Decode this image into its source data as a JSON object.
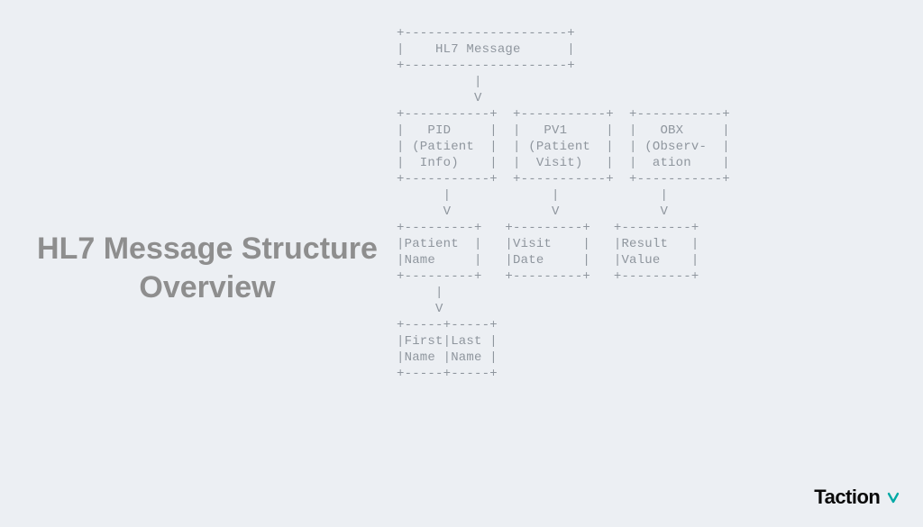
{
  "title": "HL7 Message Structure Overview",
  "brand": "Taction",
  "diagram": {
    "root": {
      "label": "HL7 Message"
    },
    "segments": [
      {
        "code": "PID",
        "description_lines": [
          "(Patient",
          "Info)"
        ]
      },
      {
        "code": "PV1",
        "description_lines": [
          "(Patient",
          "Visit)"
        ]
      },
      {
        "code": "OBX",
        "description_lines": [
          "(Observ-",
          "ation"
        ]
      }
    ],
    "fields": [
      {
        "lines": [
          "Patient",
          "Name"
        ]
      },
      {
        "lines": [
          "Visit",
          "Date"
        ]
      },
      {
        "lines": [
          "Result",
          "Value"
        ]
      }
    ],
    "subfields": [
      {
        "lines": [
          "First",
          "Name"
        ]
      },
      {
        "lines": [
          "Last",
          "Name"
        ]
      }
    ],
    "ascii": "+---------------------+\n|    HL7 Message      |\n+---------------------+\n          |\n          V\n+-----------+  +-----------+  +-----------+\n|   PID     |  |   PV1     |  |   OBX     |\n| (Patient  |  | (Patient  |  | (Observ-  |\n|  Info)    |  |  Visit)   |  |  ation    |\n+-----------+  +-----------+  +-----------+\n      |             |             |\n      V             V             V\n+---------+   +---------+   +---------+\n|Patient  |   |Visit    |   |Result   |\n|Name     |   |Date     |   |Value    |\n+---------+   +---------+   +---------+\n     |\n     V\n+-----+-----+\n|First|Last |\n|Name |Name |\n+-----+-----+"
  },
  "colors": {
    "background": "#eceff3",
    "title_text": "#8e8e8e",
    "diagram_text": "#8f969e",
    "brand_text": "#0a0a0a",
    "brand_accent": "#00a9a5"
  }
}
